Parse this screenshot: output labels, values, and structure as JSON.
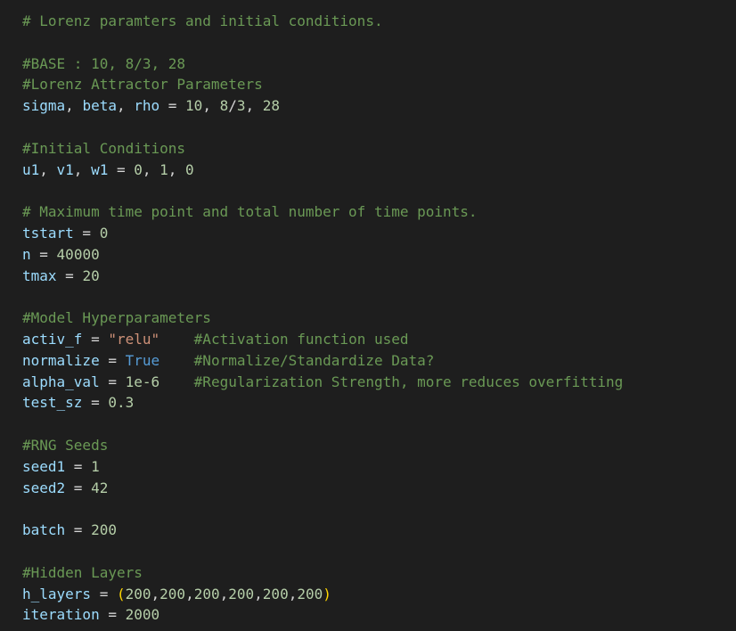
{
  "theme": {
    "background": "#1e1e1e",
    "default_text": "#d4d4d4",
    "comment": "#6a9955",
    "variable": "#9cdcfe",
    "number": "#b5cea8",
    "string": "#ce9178",
    "keyword": "#569cd6",
    "paren": "#ffd700"
  },
  "code_lines": [
    [
      {
        "t": "# Lorenz paramters and initial conditions.",
        "k": "comment"
      }
    ],
    [],
    [
      {
        "t": "#BASE : 10, 8/3, 28",
        "k": "comment"
      }
    ],
    [
      {
        "t": "#Lorenz Attractor Parameters",
        "k": "comment"
      }
    ],
    [
      {
        "t": "sigma",
        "k": "variable"
      },
      {
        "t": ", ",
        "k": "default"
      },
      {
        "t": "beta",
        "k": "variable"
      },
      {
        "t": ", ",
        "k": "default"
      },
      {
        "t": "rho",
        "k": "variable"
      },
      {
        "t": " = ",
        "k": "default"
      },
      {
        "t": "10",
        "k": "number"
      },
      {
        "t": ", ",
        "k": "default"
      },
      {
        "t": "8",
        "k": "number"
      },
      {
        "t": "/",
        "k": "default"
      },
      {
        "t": "3",
        "k": "number"
      },
      {
        "t": ", ",
        "k": "default"
      },
      {
        "t": "28",
        "k": "number"
      }
    ],
    [],
    [
      {
        "t": "#Initial Conditions",
        "k": "comment"
      }
    ],
    [
      {
        "t": "u1",
        "k": "variable"
      },
      {
        "t": ", ",
        "k": "default"
      },
      {
        "t": "v1",
        "k": "variable"
      },
      {
        "t": ", ",
        "k": "default"
      },
      {
        "t": "w1",
        "k": "variable"
      },
      {
        "t": " = ",
        "k": "default"
      },
      {
        "t": "0",
        "k": "number"
      },
      {
        "t": ", ",
        "k": "default"
      },
      {
        "t": "1",
        "k": "number"
      },
      {
        "t": ", ",
        "k": "default"
      },
      {
        "t": "0",
        "k": "number"
      }
    ],
    [],
    [
      {
        "t": "# Maximum time point and total number of time points.",
        "k": "comment"
      }
    ],
    [
      {
        "t": "tstart",
        "k": "variable"
      },
      {
        "t": " = ",
        "k": "default"
      },
      {
        "t": "0",
        "k": "number"
      }
    ],
    [
      {
        "t": "n",
        "k": "variable"
      },
      {
        "t": " = ",
        "k": "default"
      },
      {
        "t": "40000",
        "k": "number"
      }
    ],
    [
      {
        "t": "tmax",
        "k": "variable"
      },
      {
        "t": " = ",
        "k": "default"
      },
      {
        "t": "20",
        "k": "number"
      }
    ],
    [],
    [
      {
        "t": "#Model Hyperparameters",
        "k": "comment"
      }
    ],
    [
      {
        "t": "activ_f",
        "k": "variable"
      },
      {
        "t": " = ",
        "k": "default"
      },
      {
        "t": "\"relu\"",
        "k": "string"
      },
      {
        "t": "    ",
        "k": "default"
      },
      {
        "t": "#Activation function used",
        "k": "comment"
      }
    ],
    [
      {
        "t": "normalize",
        "k": "variable"
      },
      {
        "t": " = ",
        "k": "default"
      },
      {
        "t": "True",
        "k": "keyword"
      },
      {
        "t": "    ",
        "k": "default"
      },
      {
        "t": "#Normalize/Standardize Data?",
        "k": "comment"
      }
    ],
    [
      {
        "t": "alpha_val",
        "k": "variable"
      },
      {
        "t": " = ",
        "k": "default"
      },
      {
        "t": "1e-6",
        "k": "number"
      },
      {
        "t": "    ",
        "k": "default"
      },
      {
        "t": "#Regularization Strength, more reduces overfitting",
        "k": "comment"
      }
    ],
    [
      {
        "t": "test_sz",
        "k": "variable"
      },
      {
        "t": " = ",
        "k": "default"
      },
      {
        "t": "0.3",
        "k": "number"
      }
    ],
    [],
    [
      {
        "t": "#RNG Seeds",
        "k": "comment"
      }
    ],
    [
      {
        "t": "seed1",
        "k": "variable"
      },
      {
        "t": " = ",
        "k": "default"
      },
      {
        "t": "1",
        "k": "number"
      }
    ],
    [
      {
        "t": "seed2",
        "k": "variable"
      },
      {
        "t": " = ",
        "k": "default"
      },
      {
        "t": "42",
        "k": "number"
      }
    ],
    [],
    [
      {
        "t": "batch",
        "k": "variable"
      },
      {
        "t": " = ",
        "k": "default"
      },
      {
        "t": "200",
        "k": "number"
      }
    ],
    [],
    [
      {
        "t": "#Hidden Layers",
        "k": "comment"
      }
    ],
    [
      {
        "t": "h_layers",
        "k": "variable"
      },
      {
        "t": " = ",
        "k": "default"
      },
      {
        "t": "(",
        "k": "paren"
      },
      {
        "t": "200",
        "k": "number"
      },
      {
        "t": ",",
        "k": "default"
      },
      {
        "t": "200",
        "k": "number"
      },
      {
        "t": ",",
        "k": "default"
      },
      {
        "t": "200",
        "k": "number"
      },
      {
        "t": ",",
        "k": "default"
      },
      {
        "t": "200",
        "k": "number"
      },
      {
        "t": ",",
        "k": "default"
      },
      {
        "t": "200",
        "k": "number"
      },
      {
        "t": ",",
        "k": "default"
      },
      {
        "t": "200",
        "k": "number"
      },
      {
        "t": ")",
        "k": "paren"
      }
    ],
    [
      {
        "t": "iteration",
        "k": "variable"
      },
      {
        "t": " = ",
        "k": "default"
      },
      {
        "t": "2000",
        "k": "number"
      }
    ]
  ]
}
